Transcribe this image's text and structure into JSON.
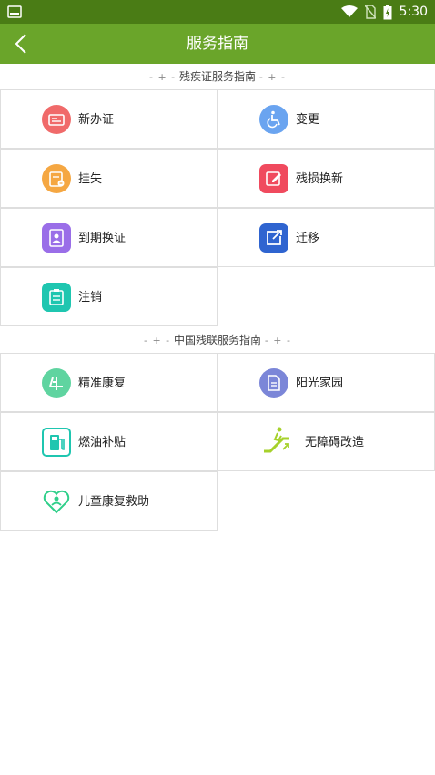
{
  "status_bar": {
    "time": "5:30"
  },
  "header": {
    "title": "服务指南"
  },
  "sections": [
    {
      "heading": "残疾证服务指南",
      "items": [
        {
          "label": "新办证",
          "icon": "id-card-icon",
          "color": "#f06a6a"
        },
        {
          "label": "变更",
          "icon": "wheelchair-icon",
          "color": "#6aa4f0"
        },
        {
          "label": "挂失",
          "icon": "lost-card-icon",
          "color": "#f5a742"
        },
        {
          "label": "残损换新",
          "icon": "edit-card-icon",
          "color": "#f04a5e"
        },
        {
          "label": "到期换证",
          "icon": "contact-card-icon",
          "color": "#9a6ee8"
        },
        {
          "label": "迁移",
          "icon": "export-icon",
          "color": "#2f64d0"
        },
        {
          "label": "注销",
          "icon": "cancel-doc-icon",
          "color": "#1fc6b0"
        }
      ]
    },
    {
      "heading": "中国残联服务指南",
      "items": [
        {
          "label": "精准康复",
          "icon": "rehab-icon",
          "color": "#5fd4a0"
        },
        {
          "label": "阳光家园",
          "icon": "document-icon",
          "color": "#7b86d8"
        },
        {
          "label": "燃油补贴",
          "icon": "fuel-pump-icon",
          "color": "#1fc6b0"
        },
        {
          "label": "无障碍改造",
          "icon": "escalator-icon",
          "color": "#a6d12b"
        },
        {
          "label": "儿童康复救助",
          "icon": "child-heart-icon",
          "color": "#2fcf8a"
        }
      ]
    }
  ]
}
